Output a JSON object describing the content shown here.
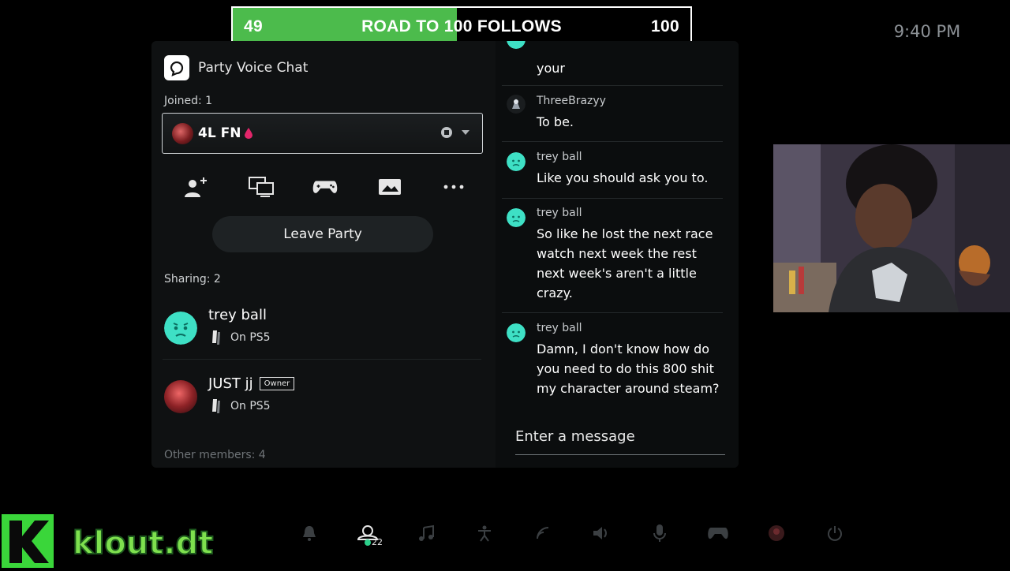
{
  "banner": {
    "start": "49",
    "title": "ROAD TO 100 FOLLOWS",
    "goal": "100",
    "progress_fraction": 0.49,
    "fill_color": "#4cbb4c"
  },
  "clock": "9:40 PM",
  "party": {
    "title": "Party Voice Chat",
    "joined_label": "Joined: 1",
    "selected_member": "4L FN",
    "leave_label": "Leave Party",
    "sharing_label": "Sharing: 2",
    "members": [
      {
        "name": "trey ball",
        "platform": "On PS5",
        "owner": false
      },
      {
        "name": "JUST jj",
        "platform": "On PS5",
        "owner": true,
        "owner_label": "Owner"
      }
    ],
    "other_members_label": "Other members: 4"
  },
  "chat": {
    "messages": [
      {
        "author": "",
        "text": "your"
      },
      {
        "author": "ThreeBrazyy",
        "text": "To be."
      },
      {
        "author": "trey ball",
        "text": "Like you should ask you to."
      },
      {
        "author": "trey ball",
        "text": "So like he lost the next race watch next week the rest next week's aren't a little crazy."
      },
      {
        "author": "trey ball",
        "text": "Damn, I don't know how do you need to do this 800 shit my character around steam?"
      }
    ],
    "input_placeholder": "Enter a message"
  },
  "dock": {
    "party_count": "22"
  },
  "logo_text": "klout.dt",
  "logo_letter": "K"
}
